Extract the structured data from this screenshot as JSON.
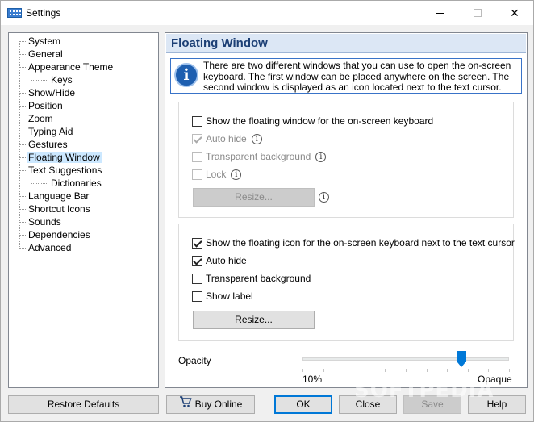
{
  "window": {
    "title": "Settings",
    "minimize_label": "minimize",
    "maximize_label": "maximize",
    "close_label": "close"
  },
  "tree": {
    "items": [
      {
        "label": "System",
        "indent": 0
      },
      {
        "label": "General",
        "indent": 0
      },
      {
        "label": "Appearance Theme",
        "indent": 0
      },
      {
        "label": "Keys",
        "indent": 1
      },
      {
        "label": "Show/Hide",
        "indent": 0
      },
      {
        "label": "Position",
        "indent": 0
      },
      {
        "label": "Zoom",
        "indent": 0
      },
      {
        "label": "Typing Aid",
        "indent": 0
      },
      {
        "label": "Gestures",
        "indent": 0
      },
      {
        "label": "Floating Window",
        "indent": 0,
        "selected": true
      },
      {
        "label": "Text Suggestions",
        "indent": 0
      },
      {
        "label": "Dictionaries",
        "indent": 1
      },
      {
        "label": "Language Bar",
        "indent": 0
      },
      {
        "label": "Shortcut Icons",
        "indent": 0
      },
      {
        "label": "Sounds",
        "indent": 0
      },
      {
        "label": "Dependencies",
        "indent": 0
      },
      {
        "label": "Advanced",
        "indent": 0
      }
    ]
  },
  "panel": {
    "title": "Floating Window",
    "info_icon": "info-icon",
    "info_glyph": "i",
    "info_text": "There are two different windows that you can use to open the on-screen keyboard. The first window can be placed anywhere on the screen. The second window is displayed as an icon located next to the text cursor."
  },
  "group1": {
    "show_floating_window": {
      "label": "Show the floating window for the on-screen keyboard",
      "checked": false
    },
    "auto_hide": {
      "label": "Auto hide",
      "checked": true,
      "disabled": true
    },
    "transparent_background": {
      "label": "Transparent background",
      "checked": false,
      "disabled": true
    },
    "lock": {
      "label": "Lock",
      "checked": false,
      "disabled": true
    },
    "resize_button": "Resize...",
    "help_glyph": "i"
  },
  "group2": {
    "show_floating_icon": {
      "label": "Show the floating icon for the on-screen keyboard next to the text cursor",
      "checked": true
    },
    "auto_hide": {
      "label": "Auto hide",
      "checked": true
    },
    "transparent_background": {
      "label": "Transparent background",
      "checked": false
    },
    "show_label": {
      "label": "Show label",
      "checked": false
    },
    "resize_button": "Resize..."
  },
  "opacity": {
    "label": "Opacity",
    "min_label": "10%",
    "max_label": "Opaque",
    "value_fraction": 0.77
  },
  "footer": {
    "restore_defaults": "Restore Defaults",
    "buy_online": "Buy Online",
    "ok": "OK",
    "close": "Close",
    "save": "Save",
    "help": "Help"
  },
  "watermark": "SOFTPEDIA",
  "colors": {
    "accent": "#0078d7",
    "header_bg": "#dce7f5",
    "header_text": "#1c3f75",
    "selection": "#cce8ff"
  }
}
